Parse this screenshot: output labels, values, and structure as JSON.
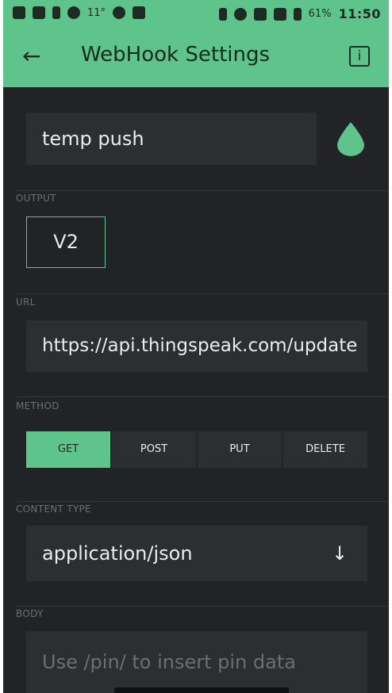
{
  "status_bar": {
    "temperature": "11°",
    "battery": "61%",
    "time": "11:50"
  },
  "app_bar": {
    "title": "WebHook Settings",
    "info_label": "i"
  },
  "widget": {
    "name": "temp push",
    "color": "#5fc48b"
  },
  "output": {
    "label": "OUTPUT",
    "pin": "V2"
  },
  "url": {
    "label": "URL",
    "value": "https://api.thingspeak.com/update"
  },
  "method": {
    "label": "METHOD",
    "options": [
      "GET",
      "POST",
      "PUT",
      "DELETE"
    ],
    "selected": "GET"
  },
  "content_type": {
    "label": "CONTENT TYPE",
    "value": "application/json"
  },
  "body": {
    "label": "BODY",
    "placeholder": "Use /pin/ to insert pin data"
  },
  "colors": {
    "accent": "#5fc48b",
    "background": "#212327",
    "field": "#2c2e32"
  }
}
